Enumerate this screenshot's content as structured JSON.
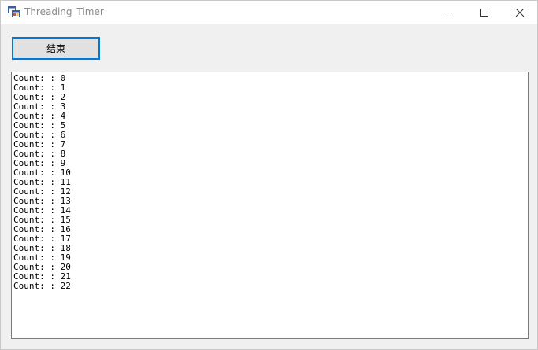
{
  "window": {
    "title": "Threading_Timer"
  },
  "icons": {
    "app": "winforms-app-icon",
    "minimize": "minimize-icon",
    "maximize": "maximize-icon",
    "close": "close-icon"
  },
  "toolbar": {
    "end_label": "结束"
  },
  "log": {
    "lines": [
      "Count: : 0",
      "Count: : 1",
      "Count: : 2",
      "Count: : 3",
      "Count: : 4",
      "Count: : 5",
      "Count: : 6",
      "Count: : 7",
      "Count: : 8",
      "Count: : 9",
      "Count: : 10",
      "Count: : 11",
      "Count: : 12",
      "Count: : 13",
      "Count: : 14",
      "Count: : 15",
      "Count: : 16",
      "Count: : 17",
      "Count: : 18",
      "Count: : 19",
      "Count: : 20",
      "Count: : 21",
      "Count: : 22"
    ]
  },
  "colors": {
    "accent": "#0078d7",
    "window_bg": "#f0f0f0",
    "title_text": "#8a8a8a"
  }
}
